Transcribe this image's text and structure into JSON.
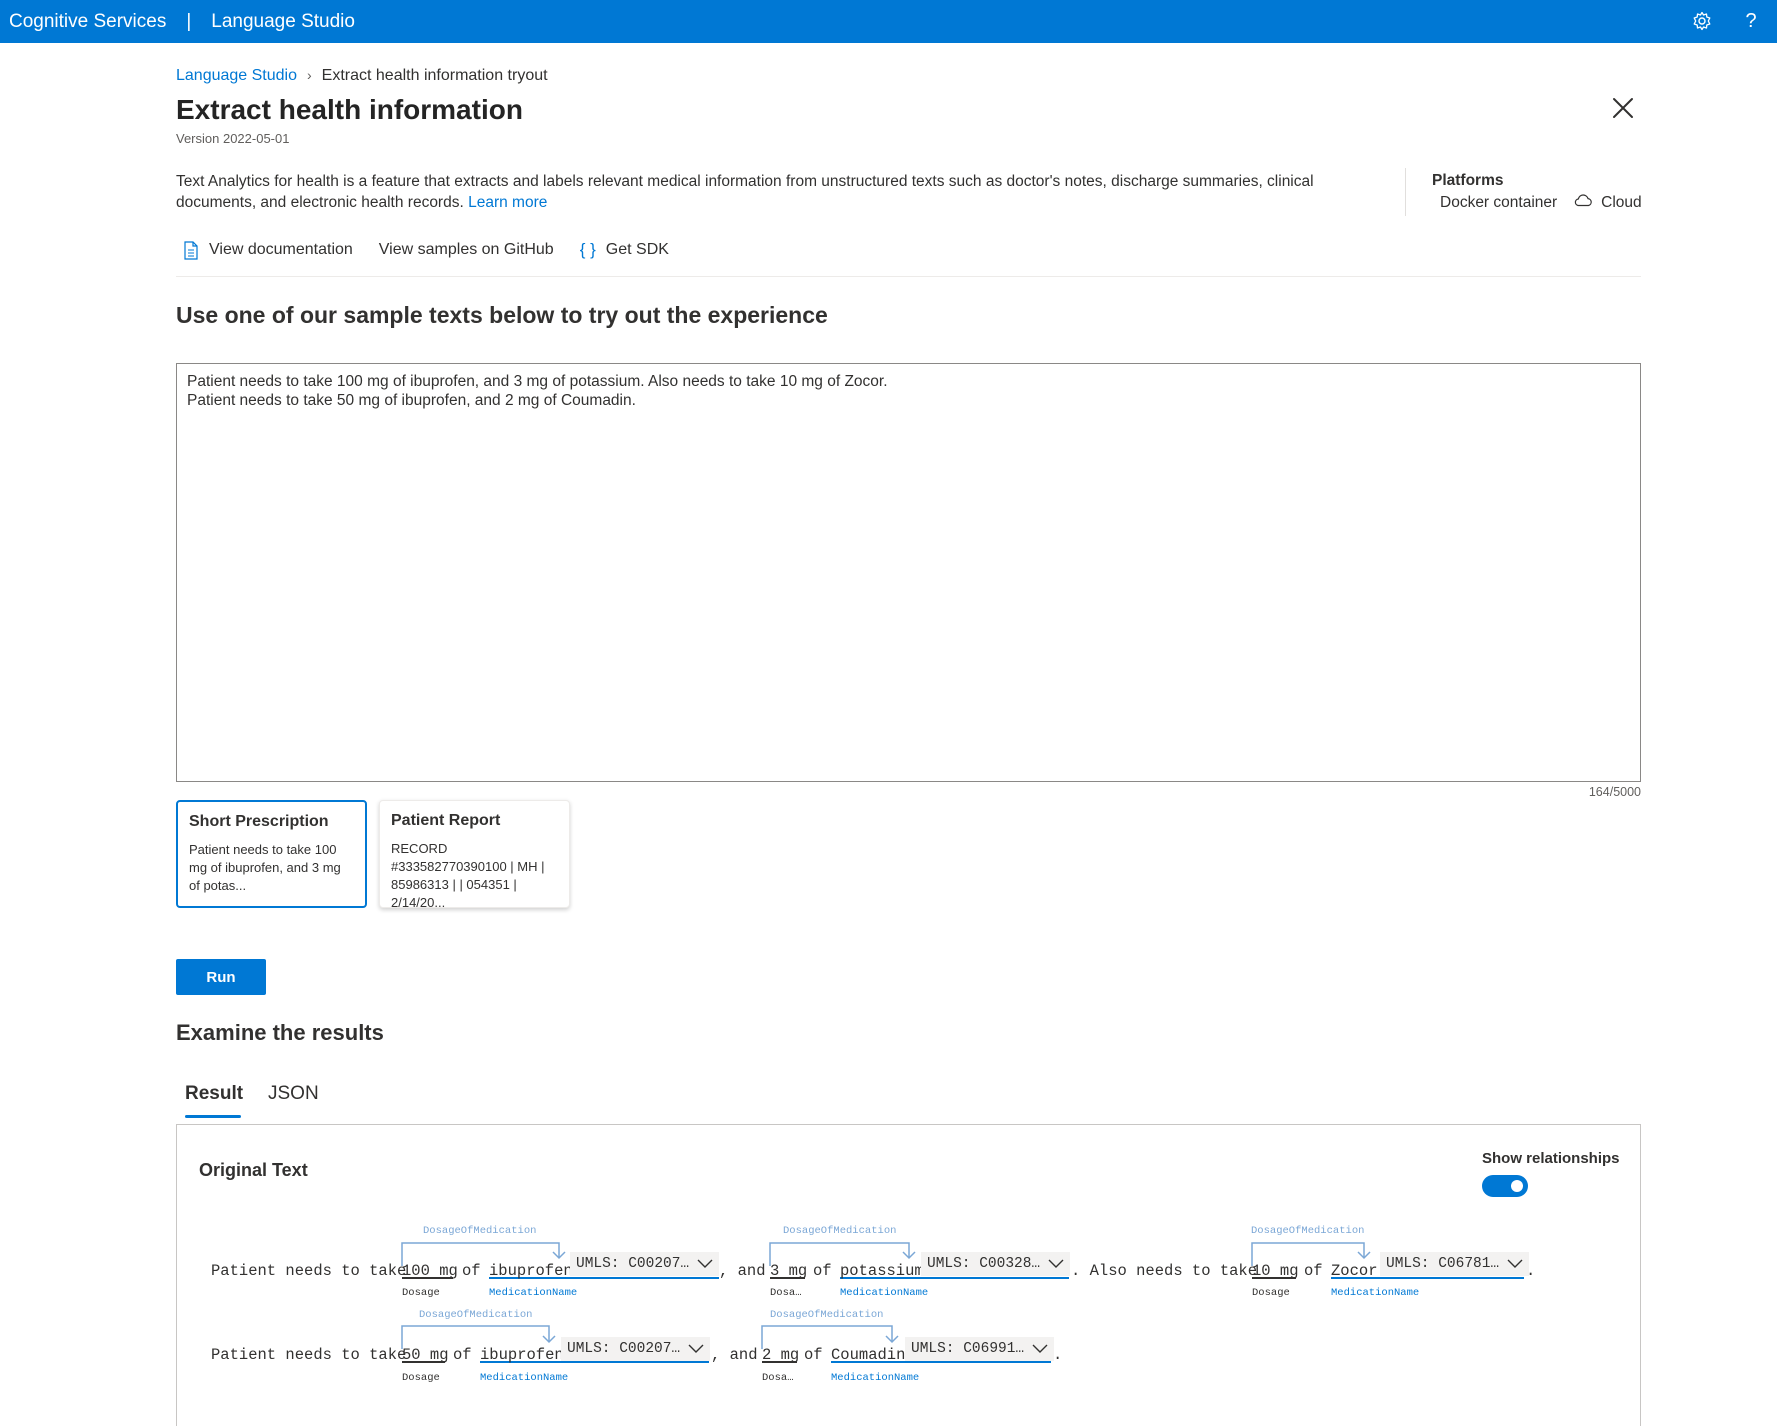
{
  "topbar": {
    "brand": "Cognitive Services",
    "separator": "|",
    "product": "Language Studio",
    "settings_icon": "gear-icon",
    "help_icon": "help-icon"
  },
  "breadcrumb": {
    "root": "Language Studio",
    "current": "Extract health information tryout"
  },
  "page": {
    "title": "Extract health information",
    "version": "Version 2022-05-01",
    "description": "Text Analytics for health is a feature that extracts and labels relevant medical information from unstructured texts such as doctor's notes, discharge summaries, clinical documents, and electronic health records.",
    "learn_more": "Learn more"
  },
  "platforms": {
    "title": "Platforms",
    "docker": "Docker container",
    "cloud": "Cloud"
  },
  "links": {
    "docs": "View documentation",
    "github": "View samples on GitHub",
    "sdk": "Get SDK"
  },
  "sample": {
    "section_title": "Use one of our sample texts below to try out the experience",
    "text": "Patient needs to take 100 mg of ibuprofen, and 3 mg of potassium. Also needs to take 10 mg of Zocor.\nPatient needs to take 50 mg of ibuprofen, and 2 mg of Coumadin.",
    "counter": "164/5000"
  },
  "cards": [
    {
      "title": "Short Prescription",
      "body": "Patient needs to take 100 mg of ibuprofen, and 3 mg of potas..."
    },
    {
      "title": "Patient Report",
      "body": "RECORD #333582770390100 | MH | 85986313 | | 054351 | 2/14/20..."
    }
  ],
  "run_label": "Run",
  "results": {
    "title": "Examine the results",
    "tabs": [
      "Result",
      "JSON"
    ],
    "original_text": "Original Text",
    "show_relationships": "Show relationships",
    "show_relationships_on": true
  },
  "annotated": {
    "relation_label": "DosageOfMedication",
    "dosage_label": "Dosage",
    "dosage_short": "Dosa…",
    "med_label": "MedicationName",
    "line1": {
      "prefix": "Patient needs to take",
      "d1": "100 mg",
      "of1": "of",
      "m1": "ibuprofen",
      "u1": "UMLS: C00207…",
      "mid1": ", and",
      "d2": "3 mg",
      "of2": "of",
      "m2": "potassium",
      "u2": "UMLS: C00328…",
      "mid2": ". Also needs to take",
      "d3": "10 mg",
      "of3": "of",
      "m3": "Zocor",
      "u3": "UMLS: C06781…",
      "end": "."
    },
    "line2": {
      "prefix": "Patient needs to take",
      "d1": "50 mg",
      "of1": "of",
      "m1": "ibuprofen",
      "u1": "UMLS: C00207…",
      "mid1": ", and",
      "d2": "2 mg",
      "of2": "of",
      "m2": "Coumadin",
      "u2": "UMLS: C06991…",
      "end": "."
    }
  },
  "colors": {
    "accent": "#0078d4",
    "relation": "#7ba7d6",
    "umls_bg": "#f3f2f1"
  }
}
